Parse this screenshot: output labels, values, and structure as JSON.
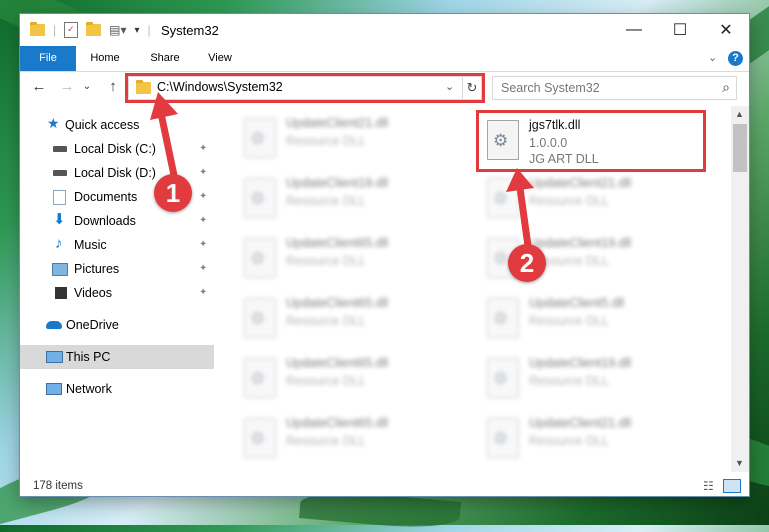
{
  "window": {
    "title": "System32",
    "controls": {
      "minimize": "—",
      "maximize": "☐",
      "close": "✕"
    }
  },
  "ribbon": {
    "tabs": [
      "File",
      "Home",
      "Share",
      "View"
    ],
    "help": "?",
    "expand": "⌄"
  },
  "nav": {
    "back": "←",
    "forward": "→",
    "recent": "⌄",
    "up": "↑"
  },
  "address": {
    "path": "C:\\Windows\\System32",
    "dropdown": "⌄",
    "refresh": "↻"
  },
  "search": {
    "placeholder": "Search System32",
    "icon": "⌕"
  },
  "sidebar": {
    "items": [
      {
        "label": "Quick access",
        "icon": "star-icon",
        "pinned": false
      },
      {
        "label": "Local Disk (C:)",
        "icon": "drive-icon",
        "pinned": true
      },
      {
        "label": "Local Disk (D:)",
        "icon": "drive-icon",
        "pinned": true
      },
      {
        "label": "Documents",
        "icon": "documents-icon",
        "pinned": true
      },
      {
        "label": "Downloads",
        "icon": "downloads-icon",
        "pinned": true
      },
      {
        "label": "Music",
        "icon": "music-icon",
        "pinned": true
      },
      {
        "label": "Pictures",
        "icon": "pictures-icon",
        "pinned": true
      },
      {
        "label": "Videos",
        "icon": "videos-icon",
        "pinned": true
      },
      {
        "label": "OneDrive",
        "icon": "onedrive-icon",
        "pinned": false
      },
      {
        "label": "This PC",
        "icon": "this-pc-icon",
        "pinned": false,
        "selected": true
      },
      {
        "label": "Network",
        "icon": "network-icon",
        "pinned": false
      }
    ],
    "pin_glyph": "📌"
  },
  "files": {
    "left": [
      {
        "name": "UpdateClient21.dll",
        "type": "Resource DLL"
      },
      {
        "name": "UpdateClient19.dll",
        "type": "Resource DLL"
      },
      {
        "name": "UpdateClient65.dll",
        "type": "Resource DLL"
      },
      {
        "name": "UpdateClient65.dll",
        "type": "Resource DLL"
      },
      {
        "name": "UpdateClient65.dll",
        "type": "Resource DLL"
      },
      {
        "name": "UpdateClient65.dll",
        "type": "Resource DLL"
      }
    ],
    "right": [
      {
        "name": "jgs7tlk.dll",
        "version": "1.0.0.0",
        "type": "JG ART DLL",
        "highlighted": true
      },
      {
        "name": "UpdateClient21.dll",
        "type": "Resource DLL"
      },
      {
        "name": "UpdateClient19.dll",
        "type": "Resource DLL"
      },
      {
        "name": "UpdateClient5.dll",
        "type": "Resource DLL"
      },
      {
        "name": "UpdateClient19.dll",
        "type": "Resource DLL"
      },
      {
        "name": "UpdateClient21.dll",
        "type": "Resource DLL"
      }
    ]
  },
  "status": {
    "count": "178 items"
  },
  "callouts": [
    "1",
    "2"
  ],
  "colors": {
    "accent": "#1979ca",
    "highlight": "#e23b3f",
    "selection": "#d9d9d9"
  }
}
